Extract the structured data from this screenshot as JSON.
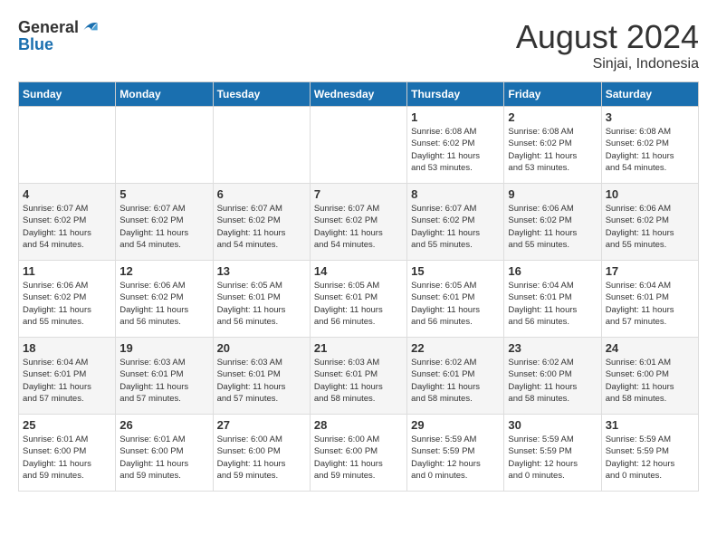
{
  "logo": {
    "general": "General",
    "blue": "Blue"
  },
  "title": {
    "month_year": "August 2024",
    "location": "Sinjai, Indonesia"
  },
  "headers": [
    "Sunday",
    "Monday",
    "Tuesday",
    "Wednesday",
    "Thursday",
    "Friday",
    "Saturday"
  ],
  "weeks": [
    [
      {
        "day": "",
        "info": ""
      },
      {
        "day": "",
        "info": ""
      },
      {
        "day": "",
        "info": ""
      },
      {
        "day": "",
        "info": ""
      },
      {
        "day": "1",
        "info": "Sunrise: 6:08 AM\nSunset: 6:02 PM\nDaylight: 11 hours\nand 53 minutes."
      },
      {
        "day": "2",
        "info": "Sunrise: 6:08 AM\nSunset: 6:02 PM\nDaylight: 11 hours\nand 53 minutes."
      },
      {
        "day": "3",
        "info": "Sunrise: 6:08 AM\nSunset: 6:02 PM\nDaylight: 11 hours\nand 54 minutes."
      }
    ],
    [
      {
        "day": "4",
        "info": "Sunrise: 6:07 AM\nSunset: 6:02 PM\nDaylight: 11 hours\nand 54 minutes."
      },
      {
        "day": "5",
        "info": "Sunrise: 6:07 AM\nSunset: 6:02 PM\nDaylight: 11 hours\nand 54 minutes."
      },
      {
        "day": "6",
        "info": "Sunrise: 6:07 AM\nSunset: 6:02 PM\nDaylight: 11 hours\nand 54 minutes."
      },
      {
        "day": "7",
        "info": "Sunrise: 6:07 AM\nSunset: 6:02 PM\nDaylight: 11 hours\nand 54 minutes."
      },
      {
        "day": "8",
        "info": "Sunrise: 6:07 AM\nSunset: 6:02 PM\nDaylight: 11 hours\nand 55 minutes."
      },
      {
        "day": "9",
        "info": "Sunrise: 6:06 AM\nSunset: 6:02 PM\nDaylight: 11 hours\nand 55 minutes."
      },
      {
        "day": "10",
        "info": "Sunrise: 6:06 AM\nSunset: 6:02 PM\nDaylight: 11 hours\nand 55 minutes."
      }
    ],
    [
      {
        "day": "11",
        "info": "Sunrise: 6:06 AM\nSunset: 6:02 PM\nDaylight: 11 hours\nand 55 minutes."
      },
      {
        "day": "12",
        "info": "Sunrise: 6:06 AM\nSunset: 6:02 PM\nDaylight: 11 hours\nand 56 minutes."
      },
      {
        "day": "13",
        "info": "Sunrise: 6:05 AM\nSunset: 6:01 PM\nDaylight: 11 hours\nand 56 minutes."
      },
      {
        "day": "14",
        "info": "Sunrise: 6:05 AM\nSunset: 6:01 PM\nDaylight: 11 hours\nand 56 minutes."
      },
      {
        "day": "15",
        "info": "Sunrise: 6:05 AM\nSunset: 6:01 PM\nDaylight: 11 hours\nand 56 minutes."
      },
      {
        "day": "16",
        "info": "Sunrise: 6:04 AM\nSunset: 6:01 PM\nDaylight: 11 hours\nand 56 minutes."
      },
      {
        "day": "17",
        "info": "Sunrise: 6:04 AM\nSunset: 6:01 PM\nDaylight: 11 hours\nand 57 minutes."
      }
    ],
    [
      {
        "day": "18",
        "info": "Sunrise: 6:04 AM\nSunset: 6:01 PM\nDaylight: 11 hours\nand 57 minutes."
      },
      {
        "day": "19",
        "info": "Sunrise: 6:03 AM\nSunset: 6:01 PM\nDaylight: 11 hours\nand 57 minutes."
      },
      {
        "day": "20",
        "info": "Sunrise: 6:03 AM\nSunset: 6:01 PM\nDaylight: 11 hours\nand 57 minutes."
      },
      {
        "day": "21",
        "info": "Sunrise: 6:03 AM\nSunset: 6:01 PM\nDaylight: 11 hours\nand 58 minutes."
      },
      {
        "day": "22",
        "info": "Sunrise: 6:02 AM\nSunset: 6:01 PM\nDaylight: 11 hours\nand 58 minutes."
      },
      {
        "day": "23",
        "info": "Sunrise: 6:02 AM\nSunset: 6:00 PM\nDaylight: 11 hours\nand 58 minutes."
      },
      {
        "day": "24",
        "info": "Sunrise: 6:01 AM\nSunset: 6:00 PM\nDaylight: 11 hours\nand 58 minutes."
      }
    ],
    [
      {
        "day": "25",
        "info": "Sunrise: 6:01 AM\nSunset: 6:00 PM\nDaylight: 11 hours\nand 59 minutes."
      },
      {
        "day": "26",
        "info": "Sunrise: 6:01 AM\nSunset: 6:00 PM\nDaylight: 11 hours\nand 59 minutes."
      },
      {
        "day": "27",
        "info": "Sunrise: 6:00 AM\nSunset: 6:00 PM\nDaylight: 11 hours\nand 59 minutes."
      },
      {
        "day": "28",
        "info": "Sunrise: 6:00 AM\nSunset: 6:00 PM\nDaylight: 11 hours\nand 59 minutes."
      },
      {
        "day": "29",
        "info": "Sunrise: 5:59 AM\nSunset: 5:59 PM\nDaylight: 12 hours\nand 0 minutes."
      },
      {
        "day": "30",
        "info": "Sunrise: 5:59 AM\nSunset: 5:59 PM\nDaylight: 12 hours\nand 0 minutes."
      },
      {
        "day": "31",
        "info": "Sunrise: 5:59 AM\nSunset: 5:59 PM\nDaylight: 12 hours\nand 0 minutes."
      }
    ]
  ]
}
